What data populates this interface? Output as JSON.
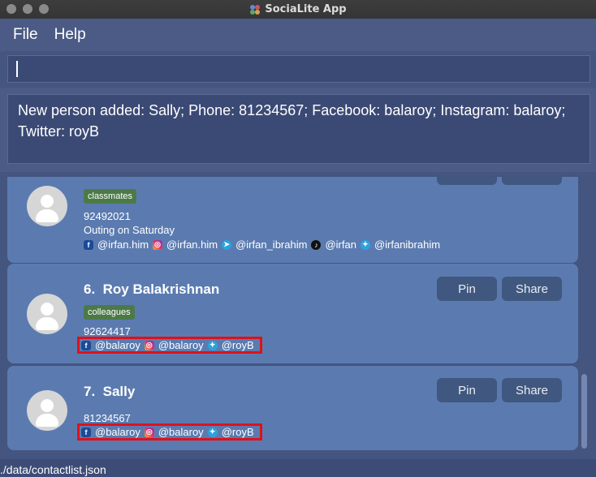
{
  "window": {
    "title": "SociaLite App"
  },
  "menu": {
    "file": "File",
    "help": "Help"
  },
  "command_input": {
    "value": ""
  },
  "result": {
    "text": "New person added: Sally; Phone: 81234567; Facebook: balaroy; Instagram: balaroy; Twitter: royB"
  },
  "cards": [
    {
      "tag": "classmates",
      "phone": "92492021",
      "remark": "Outing on Saturday",
      "socials": [
        {
          "icon": "facebook-icon",
          "handle": "@irfan.him"
        },
        {
          "icon": "instagram-icon",
          "handle": "@irfan.him"
        },
        {
          "icon": "telegram-icon",
          "handle": "@irfan_ibrahim"
        },
        {
          "icon": "tiktok-icon",
          "handle": "@irfan"
        },
        {
          "icon": "twitter-icon",
          "handle": "@irfanibrahim"
        }
      ]
    },
    {
      "index": "6.",
      "name": "Roy Balakrishnan",
      "tag": "colleagues",
      "phone": "92624417",
      "socials": [
        {
          "icon": "facebook-icon",
          "handle": "@balaroy"
        },
        {
          "icon": "instagram-icon",
          "handle": "@balaroy"
        },
        {
          "icon": "twitter-icon",
          "handle": "@royB"
        }
      ],
      "pin_label": "Pin",
      "share_label": "Share"
    },
    {
      "index": "7.",
      "name": "Sally",
      "phone": "81234567",
      "socials": [
        {
          "icon": "facebook-icon",
          "handle": "@balaroy"
        },
        {
          "icon": "instagram-icon",
          "handle": "@balaroy"
        },
        {
          "icon": "twitter-icon",
          "handle": "@royB"
        }
      ],
      "pin_label": "Pin",
      "share_label": "Share"
    }
  ],
  "status": {
    "path": "./data/contactlist.json"
  },
  "colors": {
    "background": "#44557f",
    "card": "#5b7bb0",
    "tag": "#4c7a47",
    "highlight": "#e0101a"
  }
}
